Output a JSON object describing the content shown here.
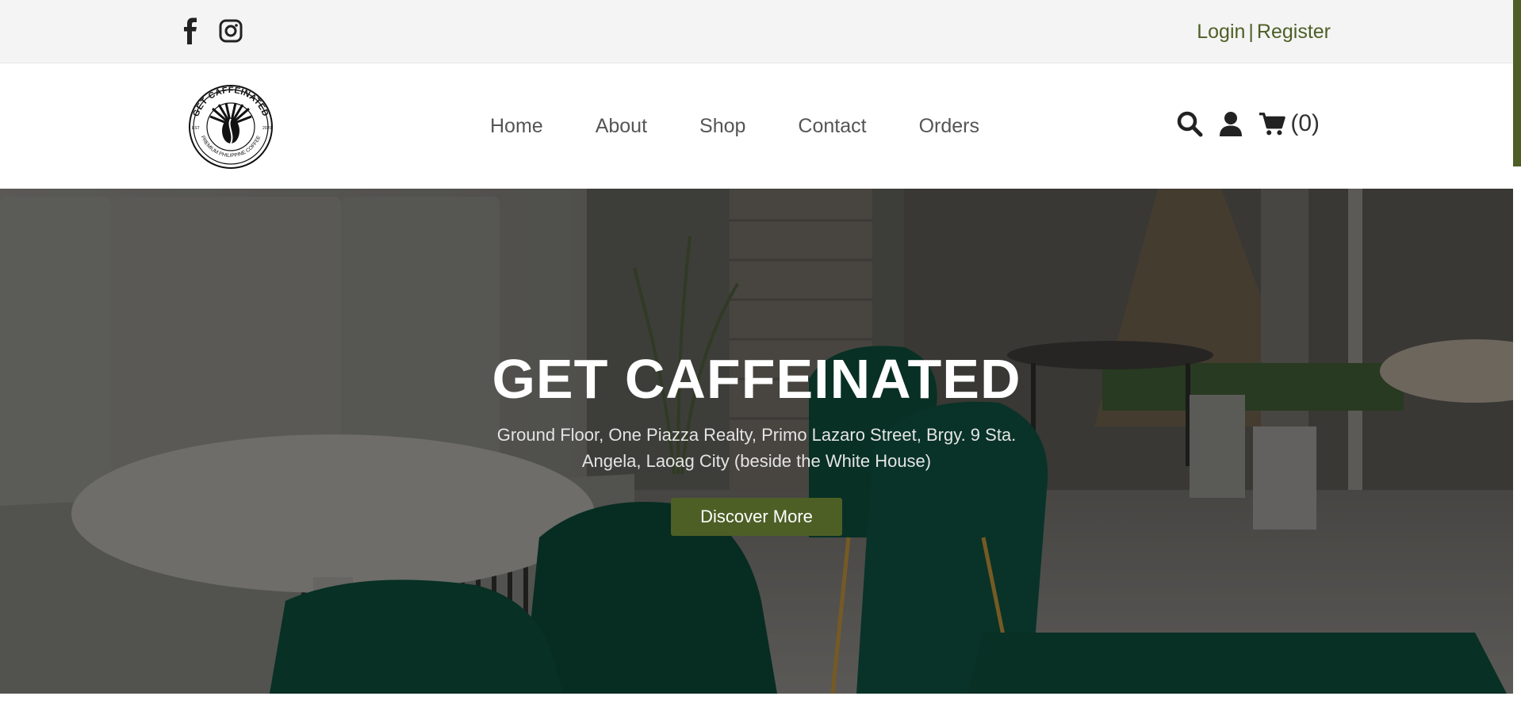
{
  "topbar": {
    "social_icons": [
      "facebook-icon",
      "instagram-icon"
    ],
    "login_label": "Login",
    "separator": "|",
    "register_label": "Register"
  },
  "header": {
    "logo": {
      "top_text": "GET CAFFEINATED",
      "bottom_text": "PREMIUM PHILIPPINE COFFEE",
      "left_text": "EST",
      "right_text": "2020"
    },
    "nav": [
      {
        "label": "Home"
      },
      {
        "label": "About"
      },
      {
        "label": "Shop"
      },
      {
        "label": "Contact"
      },
      {
        "label": "Orders"
      }
    ],
    "tools": {
      "icons": [
        "search-icon",
        "user-icon",
        "cart-icon"
      ],
      "cart_count": "(0)"
    }
  },
  "hero": {
    "title": "GET CAFFEINATED",
    "subtitle": "Ground Floor, One Piazza Realty, Primo Lazaro Street, Brgy. 9 Sta. Angela, Laoag City (beside the White House)",
    "button_label": "Discover More"
  },
  "colors": {
    "accent": "#4d5f25",
    "topbar_bg": "#f4f4f4",
    "nav_text": "#555555",
    "chair_green": "#0d4a3a"
  }
}
